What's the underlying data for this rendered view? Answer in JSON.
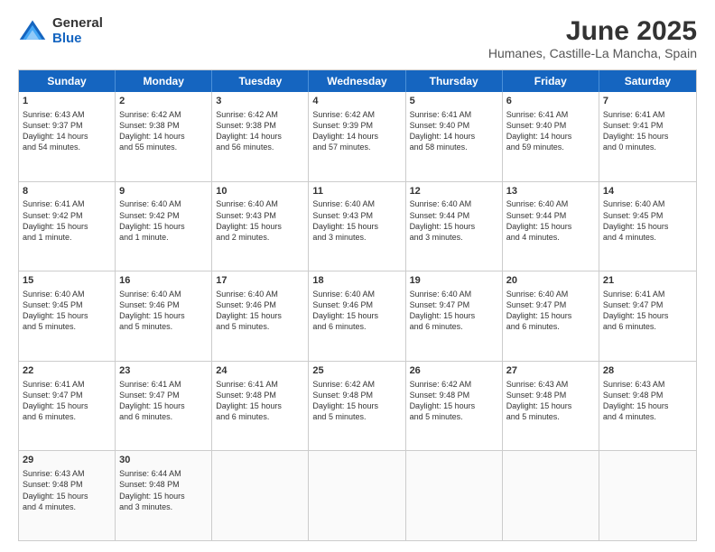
{
  "logo": {
    "general": "General",
    "blue": "Blue"
  },
  "title": "June 2025",
  "subtitle": "Humanes, Castille-La Mancha, Spain",
  "headers": [
    "Sunday",
    "Monday",
    "Tuesday",
    "Wednesday",
    "Thursday",
    "Friday",
    "Saturday"
  ],
  "rows": [
    [
      {
        "day": "1",
        "lines": [
          "Sunrise: 6:43 AM",
          "Sunset: 9:37 PM",
          "Daylight: 14 hours",
          "and 54 minutes."
        ]
      },
      {
        "day": "2",
        "lines": [
          "Sunrise: 6:42 AM",
          "Sunset: 9:38 PM",
          "Daylight: 14 hours",
          "and 55 minutes."
        ]
      },
      {
        "day": "3",
        "lines": [
          "Sunrise: 6:42 AM",
          "Sunset: 9:38 PM",
          "Daylight: 14 hours",
          "and 56 minutes."
        ]
      },
      {
        "day": "4",
        "lines": [
          "Sunrise: 6:42 AM",
          "Sunset: 9:39 PM",
          "Daylight: 14 hours",
          "and 57 minutes."
        ]
      },
      {
        "day": "5",
        "lines": [
          "Sunrise: 6:41 AM",
          "Sunset: 9:40 PM",
          "Daylight: 14 hours",
          "and 58 minutes."
        ]
      },
      {
        "day": "6",
        "lines": [
          "Sunrise: 6:41 AM",
          "Sunset: 9:40 PM",
          "Daylight: 14 hours",
          "and 59 minutes."
        ]
      },
      {
        "day": "7",
        "lines": [
          "Sunrise: 6:41 AM",
          "Sunset: 9:41 PM",
          "Daylight: 15 hours",
          "and 0 minutes."
        ]
      }
    ],
    [
      {
        "day": "8",
        "lines": [
          "Sunrise: 6:41 AM",
          "Sunset: 9:42 PM",
          "Daylight: 15 hours",
          "and 1 minute."
        ]
      },
      {
        "day": "9",
        "lines": [
          "Sunrise: 6:40 AM",
          "Sunset: 9:42 PM",
          "Daylight: 15 hours",
          "and 1 minute."
        ]
      },
      {
        "day": "10",
        "lines": [
          "Sunrise: 6:40 AM",
          "Sunset: 9:43 PM",
          "Daylight: 15 hours",
          "and 2 minutes."
        ]
      },
      {
        "day": "11",
        "lines": [
          "Sunrise: 6:40 AM",
          "Sunset: 9:43 PM",
          "Daylight: 15 hours",
          "and 3 minutes."
        ]
      },
      {
        "day": "12",
        "lines": [
          "Sunrise: 6:40 AM",
          "Sunset: 9:44 PM",
          "Daylight: 15 hours",
          "and 3 minutes."
        ]
      },
      {
        "day": "13",
        "lines": [
          "Sunrise: 6:40 AM",
          "Sunset: 9:44 PM",
          "Daylight: 15 hours",
          "and 4 minutes."
        ]
      },
      {
        "day": "14",
        "lines": [
          "Sunrise: 6:40 AM",
          "Sunset: 9:45 PM",
          "Daylight: 15 hours",
          "and 4 minutes."
        ]
      }
    ],
    [
      {
        "day": "15",
        "lines": [
          "Sunrise: 6:40 AM",
          "Sunset: 9:45 PM",
          "Daylight: 15 hours",
          "and 5 minutes."
        ]
      },
      {
        "day": "16",
        "lines": [
          "Sunrise: 6:40 AM",
          "Sunset: 9:46 PM",
          "Daylight: 15 hours",
          "and 5 minutes."
        ]
      },
      {
        "day": "17",
        "lines": [
          "Sunrise: 6:40 AM",
          "Sunset: 9:46 PM",
          "Daylight: 15 hours",
          "and 5 minutes."
        ]
      },
      {
        "day": "18",
        "lines": [
          "Sunrise: 6:40 AM",
          "Sunset: 9:46 PM",
          "Daylight: 15 hours",
          "and 6 minutes."
        ]
      },
      {
        "day": "19",
        "lines": [
          "Sunrise: 6:40 AM",
          "Sunset: 9:47 PM",
          "Daylight: 15 hours",
          "and 6 minutes."
        ]
      },
      {
        "day": "20",
        "lines": [
          "Sunrise: 6:40 AM",
          "Sunset: 9:47 PM",
          "Daylight: 15 hours",
          "and 6 minutes."
        ]
      },
      {
        "day": "21",
        "lines": [
          "Sunrise: 6:41 AM",
          "Sunset: 9:47 PM",
          "Daylight: 15 hours",
          "and 6 minutes."
        ]
      }
    ],
    [
      {
        "day": "22",
        "lines": [
          "Sunrise: 6:41 AM",
          "Sunset: 9:47 PM",
          "Daylight: 15 hours",
          "and 6 minutes."
        ]
      },
      {
        "day": "23",
        "lines": [
          "Sunrise: 6:41 AM",
          "Sunset: 9:47 PM",
          "Daylight: 15 hours",
          "and 6 minutes."
        ]
      },
      {
        "day": "24",
        "lines": [
          "Sunrise: 6:41 AM",
          "Sunset: 9:48 PM",
          "Daylight: 15 hours",
          "and 6 minutes."
        ]
      },
      {
        "day": "25",
        "lines": [
          "Sunrise: 6:42 AM",
          "Sunset: 9:48 PM",
          "Daylight: 15 hours",
          "and 5 minutes."
        ]
      },
      {
        "day": "26",
        "lines": [
          "Sunrise: 6:42 AM",
          "Sunset: 9:48 PM",
          "Daylight: 15 hours",
          "and 5 minutes."
        ]
      },
      {
        "day": "27",
        "lines": [
          "Sunrise: 6:43 AM",
          "Sunset: 9:48 PM",
          "Daylight: 15 hours",
          "and 5 minutes."
        ]
      },
      {
        "day": "28",
        "lines": [
          "Sunrise: 6:43 AM",
          "Sunset: 9:48 PM",
          "Daylight: 15 hours",
          "and 4 minutes."
        ]
      }
    ],
    [
      {
        "day": "29",
        "lines": [
          "Sunrise: 6:43 AM",
          "Sunset: 9:48 PM",
          "Daylight: 15 hours",
          "and 4 minutes."
        ]
      },
      {
        "day": "30",
        "lines": [
          "Sunrise: 6:44 AM",
          "Sunset: 9:48 PM",
          "Daylight: 15 hours",
          "and 3 minutes."
        ]
      },
      {
        "day": "",
        "lines": []
      },
      {
        "day": "",
        "lines": []
      },
      {
        "day": "",
        "lines": []
      },
      {
        "day": "",
        "lines": []
      },
      {
        "day": "",
        "lines": []
      }
    ]
  ]
}
